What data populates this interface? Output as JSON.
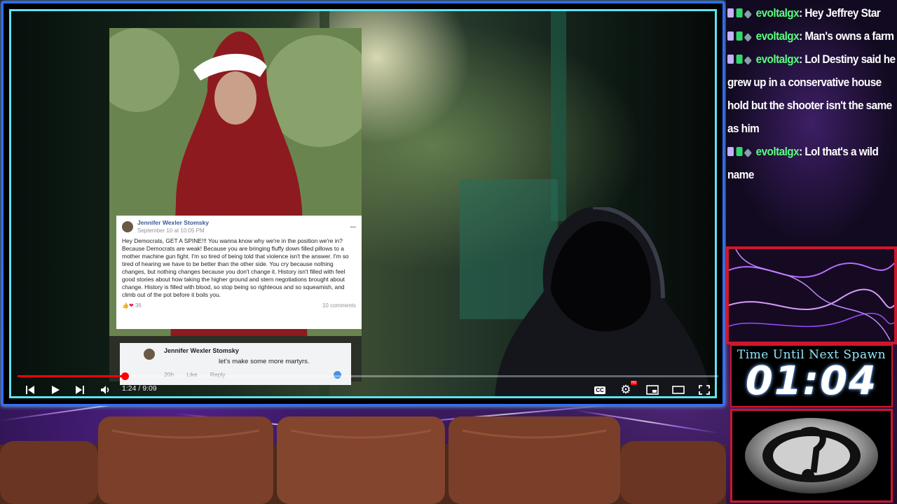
{
  "player": {
    "current_time": "1:24",
    "duration": "9:09",
    "time_text": "1:24 / 9:09",
    "progress_fraction": 0.153,
    "cc_label": "CC",
    "hd_badge": "HD"
  },
  "post": {
    "author": "Jennifer Wexler Stomsky",
    "date": "September 10 at 10:05 PM",
    "body": "Hey Democrats, GET A          SPINE!!! You wanna know why we're in the position we're in? Because Democrats are weak! Because you are bringing fluffy down filled pillows to a mother          machine gun fight. I'm so tired of being told that violence isn't the answer. I'm so tired of hearing we have to be better than the other side. You cry because nothing          changes, but nothing changes because you don't change it. History isn't filled with feel good stories about how taking the higher ground and stern negotiations brought about change. History is filled with blood, so stop being so          righteous and so          squeamish, and climb out of the          pot before it boils you.",
    "reactions_count": "36",
    "comments_count": "10 comments",
    "options_glyph": "•••"
  },
  "comment": {
    "author": "Jennifer Wexler Stomsky",
    "text": "let's make some more martyrs.",
    "age": "20h",
    "like_label": "Like",
    "reply_label": "Reply"
  },
  "chat": {
    "messages": [
      {
        "user": "evoltalgx",
        "text": ": Hey Jeffrey Star"
      },
      {
        "user": "evoltalgx",
        "text": ": Man's owns a farm"
      },
      {
        "user": "evoltalgx",
        "text": ": Lol Destiny said he grew up in a conservative house hold but the shooter isn't the same as him"
      },
      {
        "user": "evoltalgx",
        "text": ": Lol that's a wild name"
      }
    ]
  },
  "timer": {
    "label": "Time Until Next Spawn",
    "value": "01:04"
  },
  "colors": {
    "progress": "#ff0000",
    "chat_user": "#59ff7f",
    "panel_border": "#d0162c",
    "frame_cyan": "#5fe3f0"
  },
  "icons": [
    "previous-icon",
    "play-icon",
    "next-icon",
    "volume-icon",
    "captions-icon",
    "settings-icon",
    "miniplayer-icon",
    "theater-icon",
    "fullscreen-icon"
  ]
}
